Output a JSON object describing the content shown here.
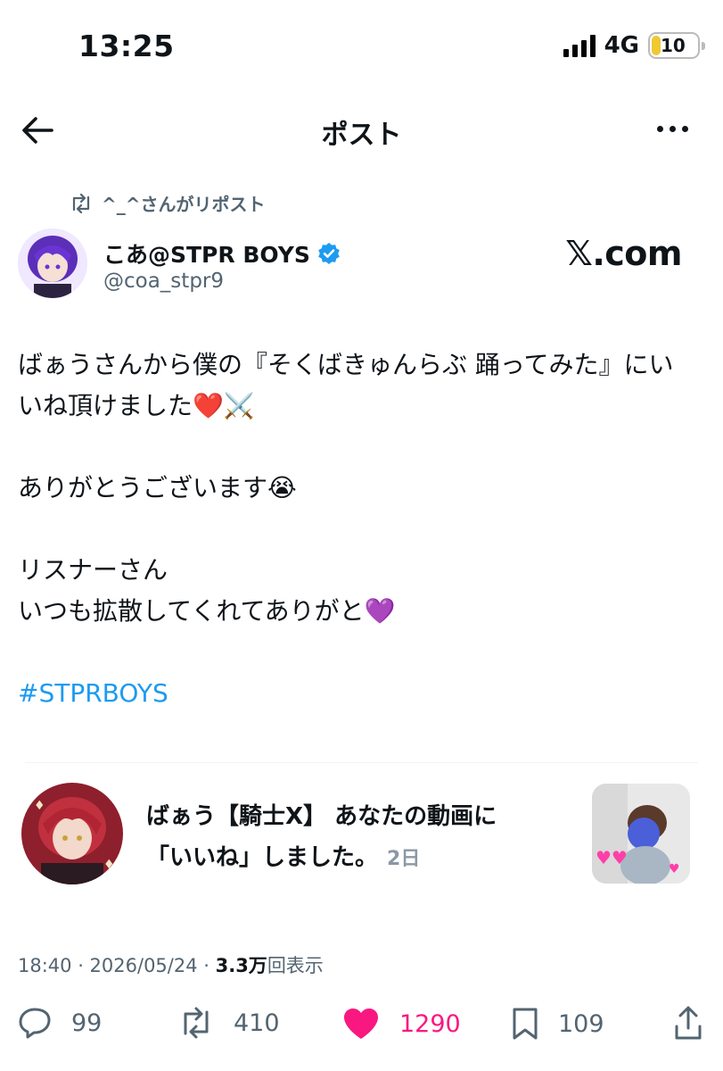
{
  "status_bar": {
    "time": "13:25",
    "network": "4G",
    "battery": "10"
  },
  "header": {
    "title": "ポスト"
  },
  "repost": {
    "text": "^_^さんがリポスト"
  },
  "author": {
    "name": "こあ@STPR BOYS",
    "handle": "@coa_stpr9",
    "verified": true
  },
  "watermark": "𝕏.com",
  "post": {
    "line1": "ばぁうさんから僕の『そくばきゅんらぶ 踊ってみた』にい",
    "line2": "いね頂けました❤️⚔️",
    "line3": "ありがとうございます😭",
    "line4": "リスナーさん",
    "line5": "いつも拡散してくれてありがと💜",
    "hashtag": "#STPRBOYS"
  },
  "embedded": {
    "line1": "ばぁう【騎士X】 あなたの動画に",
    "line2": "「いいね」しました。",
    "time": "2日"
  },
  "meta": {
    "datetime": "18:40 · 2026/05/24 · ",
    "views": "3.3万",
    "views_label": "回表示"
  },
  "actions": {
    "replies": "99",
    "reposts": "410",
    "likes": "1290",
    "bookmarks": "109"
  },
  "colors": {
    "accent": "#1d9bf0",
    "like": "#f91880",
    "muted": "#536471"
  }
}
